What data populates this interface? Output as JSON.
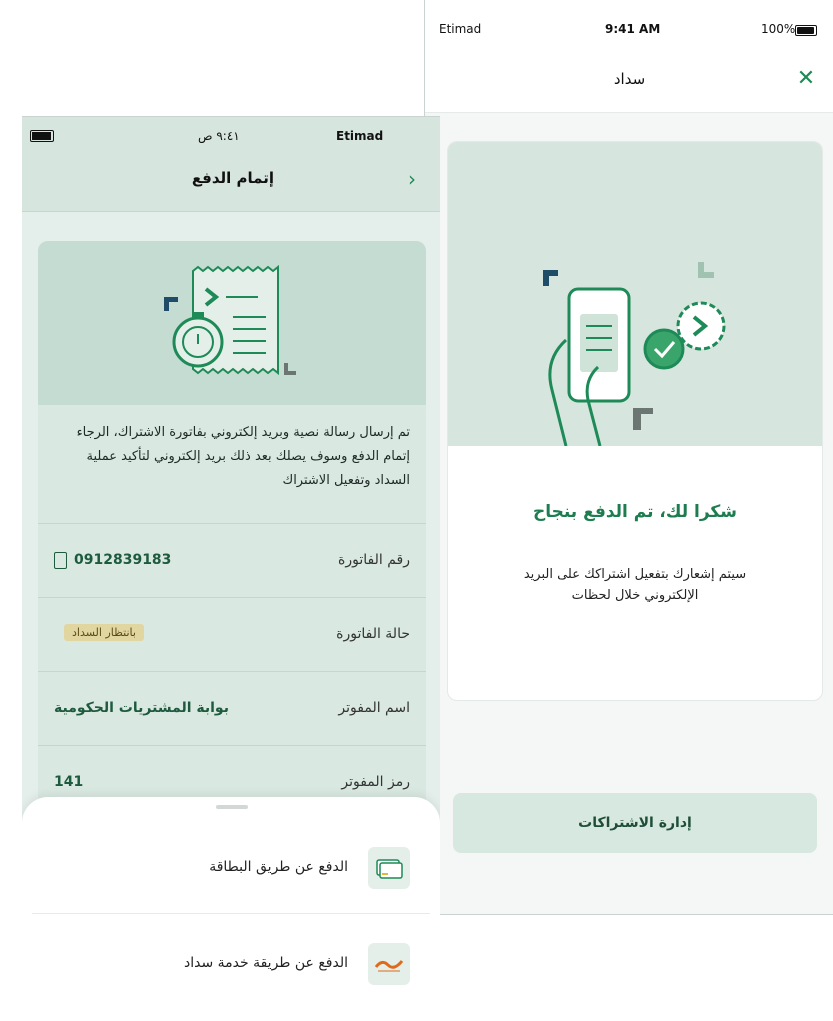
{
  "right_screen": {
    "status_bar": {
      "carrier": "Etimad",
      "time": "9:41 AM",
      "battery": "100%"
    },
    "navbar": {
      "title": "سداد",
      "close_icon": "close-icon"
    },
    "success_card": {
      "heading": "شكرا لك، تم الدفع بنجاح",
      "description": "سيتم إشعارك بتفعيل اشتراكك على البريد الإلكتروني خلال لحظات"
    },
    "manage_button": "إدارة الاشتراكات"
  },
  "left_screen": {
    "status_bar": {
      "carrier": "Etimad",
      "time": "٩:٤١ ص"
    },
    "navbar": {
      "title": "إتمام الدفع",
      "back_icon": "chevron-right-icon"
    },
    "info_card": {
      "message": "تم إرسال رسالة نصية وبريد إلكتروني بفاتورة الاشتراك، الرجاء إتمام الدفع وسوف يصلك بعد ذلك بريد إلكتروني لتأكيد عملية السداد وتفعيل الاشتراك",
      "rows": [
        {
          "label": "رقم الفاتورة",
          "value": "0912839183"
        },
        {
          "label": "حالة الفاتورة",
          "value": "بانتظار السداد"
        },
        {
          "label": "اسم المفوتر",
          "value": "بوابة المشتريات الحكومية"
        },
        {
          "label": "رمز المفوتر",
          "value": "141"
        }
      ]
    },
    "payment_options": [
      {
        "label": "الدفع عن طريق البطاقة",
        "icon": "credit-card-icon"
      },
      {
        "label": "الدفع عن طريقة خدمة سداد",
        "icon": "sadad-logo-icon"
      }
    ]
  },
  "colors": {
    "accent": "#1e8a57",
    "mint": "#d6e5de",
    "pending": "#e2d6a0"
  }
}
